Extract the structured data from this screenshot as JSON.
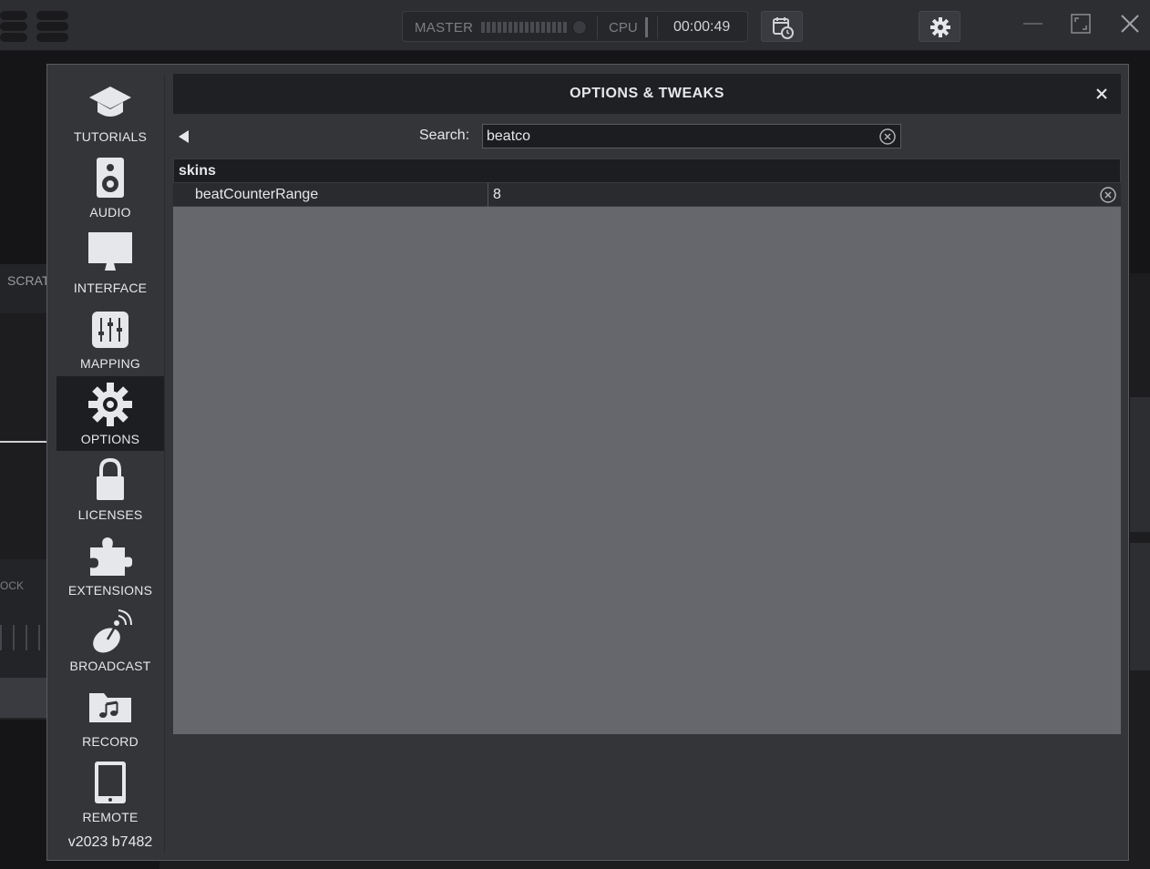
{
  "topbar": {
    "master_label": "MASTER",
    "cpu_label": "CPU",
    "time": "00:00:49",
    "icons": [
      "logo-icon",
      "calendar-clock-icon",
      "gear-icon",
      "minimize-icon",
      "maximize-icon",
      "close-icon"
    ]
  },
  "background": {
    "scratch_label": "SCRAT",
    "ock_label": "OCK"
  },
  "sidebar": {
    "items": [
      {
        "label": "TUTORIALS",
        "icon": "graduation-cap-icon"
      },
      {
        "label": "AUDIO",
        "icon": "speaker-icon"
      },
      {
        "label": "INTERFACE",
        "icon": "monitor-icon"
      },
      {
        "label": "MAPPING",
        "icon": "sliders-icon"
      },
      {
        "label": "OPTIONS",
        "icon": "gear-icon",
        "active": true
      },
      {
        "label": "LICENSES",
        "icon": "lock-icon"
      },
      {
        "label": "EXTENSIONS",
        "icon": "puzzle-icon"
      },
      {
        "label": "BROADCAST",
        "icon": "satellite-dish-icon"
      },
      {
        "label": "RECORD",
        "icon": "music-folder-icon"
      },
      {
        "label": "REMOTE",
        "icon": "tablet-icon"
      }
    ],
    "version": "v2023 b7482"
  },
  "dialog": {
    "title": "OPTIONS & TWEAKS",
    "search_label": "Search:",
    "search_value": "beatco",
    "groups": [
      {
        "name": "skins",
        "options": [
          {
            "key": "beatCounterRange",
            "value": "8"
          }
        ]
      }
    ]
  },
  "colors": {
    "topbar_bg": "#2d2e32",
    "dialog_bg": "#343539",
    "results_bg": "#66676d",
    "active_nav_bg": "#1d1e21",
    "text": "#e6e7ea"
  }
}
